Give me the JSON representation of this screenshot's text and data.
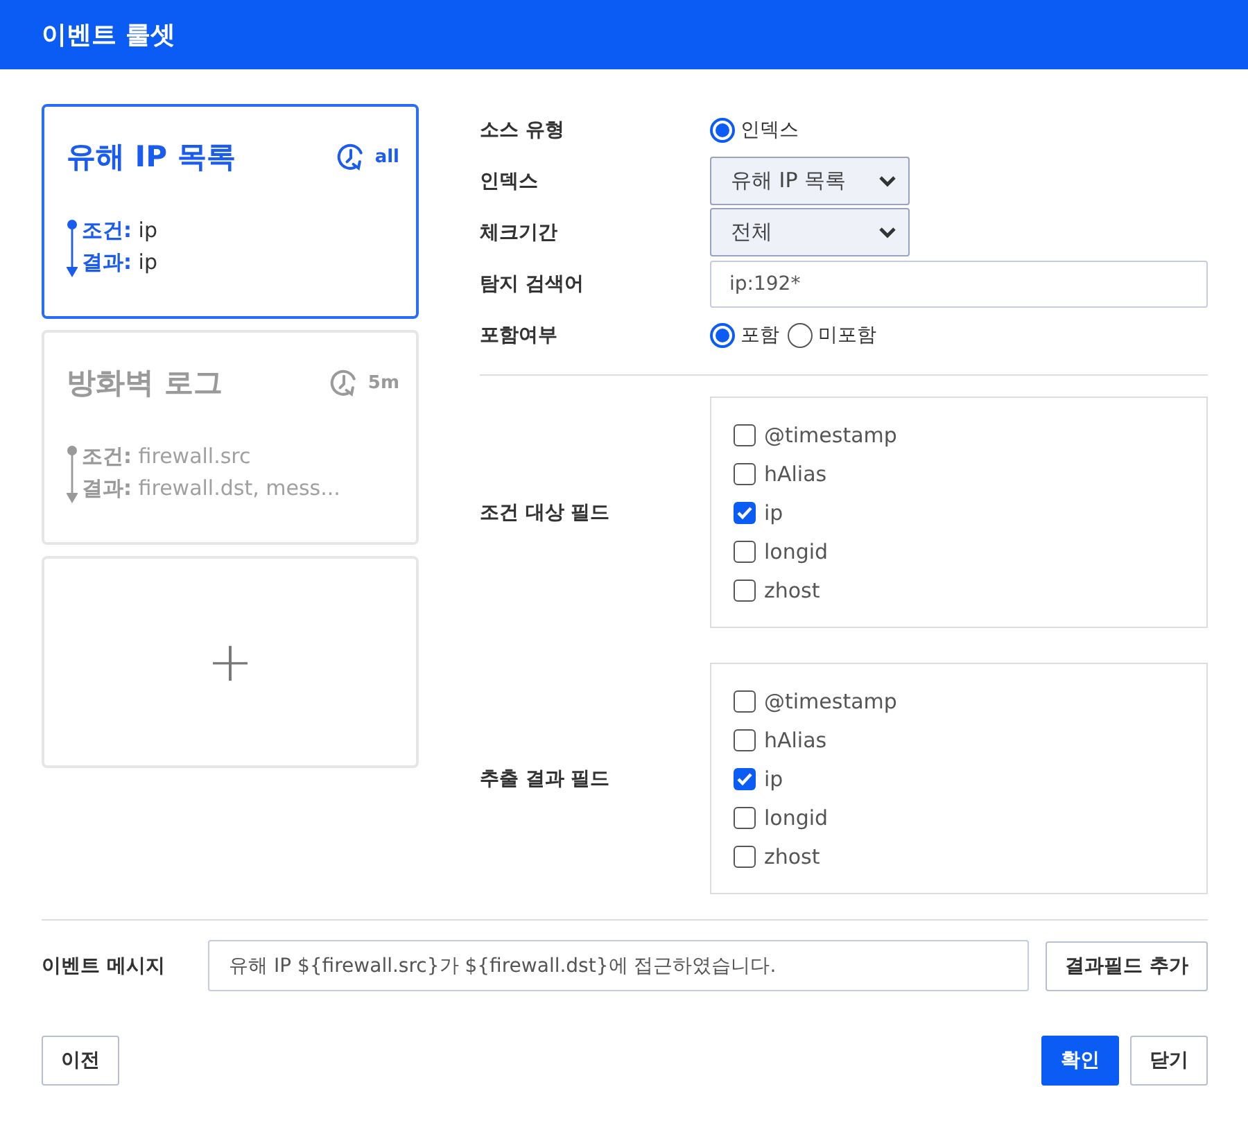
{
  "window": {
    "title": "이벤트 룰셋"
  },
  "rulesets": [
    {
      "name": "유해 IP 목록",
      "interval": "all",
      "condition_label": "조건:",
      "condition": "ip",
      "result_label": "결과:",
      "result": "ip",
      "selected": true
    },
    {
      "name": "방화벽 로그",
      "interval": "5m",
      "condition_label": "조건:",
      "condition": "firewall.src",
      "result_label": "결과:",
      "result": "firewall.dst, mess...",
      "selected": false
    }
  ],
  "add_ruleset": "+",
  "form": {
    "source_type": {
      "label": "소스 유형",
      "options": [
        {
          "label": "인덱스",
          "selected": true
        }
      ]
    },
    "index": {
      "label": "인덱스",
      "value": "유해 IP 목록"
    },
    "period": {
      "label": "체크기간",
      "value": "전체"
    },
    "query": {
      "label": "탐지 검색어",
      "value": "ip:192*"
    },
    "include": {
      "label": "포함여부",
      "options": [
        {
          "label": "포함",
          "selected": true
        },
        {
          "label": "미포함",
          "selected": false
        }
      ]
    },
    "condition_fields": {
      "label": "조건 대상 필드",
      "fields": [
        {
          "name": "@timestamp",
          "checked": false
        },
        {
          "name": "hAlias",
          "checked": false
        },
        {
          "name": "ip",
          "checked": true
        },
        {
          "name": "longid",
          "checked": false
        },
        {
          "name": "zhost",
          "checked": false
        }
      ]
    },
    "result_fields": {
      "label": "추출 결과 필드",
      "fields": [
        {
          "name": "@timestamp",
          "checked": false
        },
        {
          "name": "hAlias",
          "checked": false
        },
        {
          "name": "ip",
          "checked": true
        },
        {
          "name": "longid",
          "checked": false
        },
        {
          "name": "zhost",
          "checked": false
        }
      ]
    }
  },
  "message": {
    "label": "이벤트 메시지",
    "value": "유해 IP ${firewall.src}가 ${firewall.dst}에 접근하였습니다.",
    "add_button": "결과필드 추가"
  },
  "buttons": {
    "prev": "이전",
    "ok": "확인",
    "close": "닫기"
  }
}
